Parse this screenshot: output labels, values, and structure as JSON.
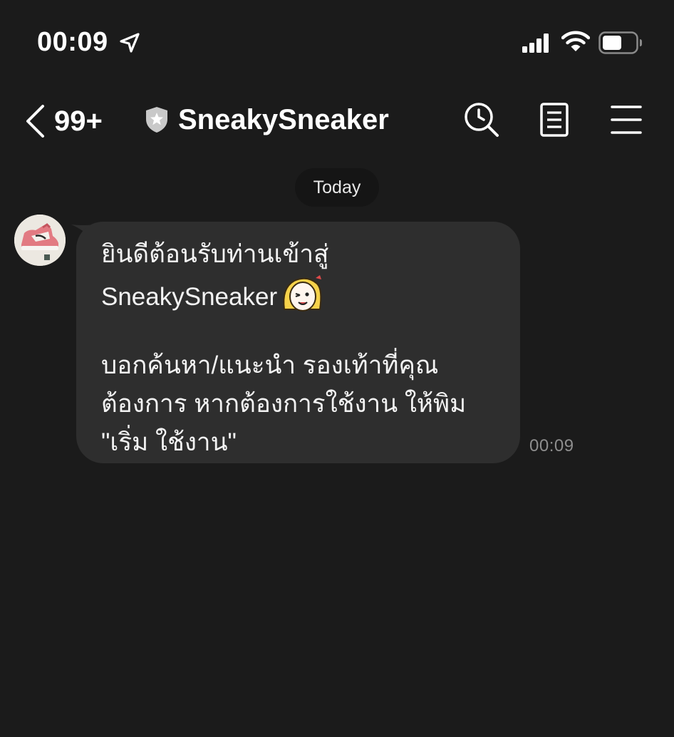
{
  "status_bar": {
    "time": "00:09"
  },
  "header": {
    "unread_count": "99+",
    "title": "SneakySneaker"
  },
  "chat": {
    "date_label": "Today",
    "messages": [
      {
        "sender": "SneakySneaker",
        "lines": [
          "ยินดีต้อนรับท่านเข้าสู่",
          "SneakySneaker",
          "บอกค้นหา/แนะนำ รองเท้าที่คุณ",
          "ต้องการ หากต้องการใช้งาน ให้พิม",
          "\"เริ่ม ใช้งาน\""
        ],
        "time": "00:09"
      }
    ]
  },
  "colors": {
    "background": "#1b1b1b",
    "bubble": "#2e2e2e",
    "date_chip": "#151515",
    "timestamp": "#8d8d8d"
  },
  "icons": [
    "location-arrow-icon",
    "signal-icon",
    "wifi-icon",
    "battery-icon",
    "back-chevron-icon",
    "shield-icon",
    "search-icon",
    "notes-icon",
    "menu-icon",
    "sneaker-avatar-icon",
    "sticker-emoji-icon"
  ]
}
